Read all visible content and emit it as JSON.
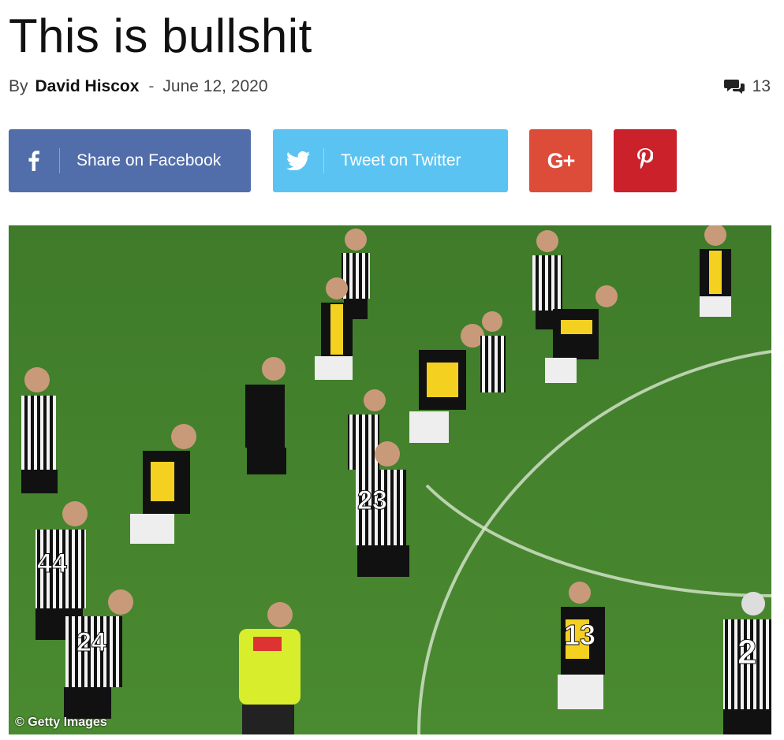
{
  "article": {
    "title": "This is bullshit",
    "by_label": "By",
    "author": "David Hiscox",
    "separator": "-",
    "date": "June 12, 2020",
    "comment_count": "13"
  },
  "share": {
    "facebook_label": "Share on Facebook",
    "twitter_label": "Tweet on Twitter",
    "googleplus_label": "G+",
    "colors": {
      "facebook": "#516eab",
      "twitter": "#5bc3f2",
      "googleplus": "#dd4b39",
      "pinterest": "#ca212a"
    }
  },
  "image": {
    "credit": "© Getty Images",
    "jersey_numbers": [
      "23",
      "44",
      "24",
      "13",
      "2"
    ]
  }
}
